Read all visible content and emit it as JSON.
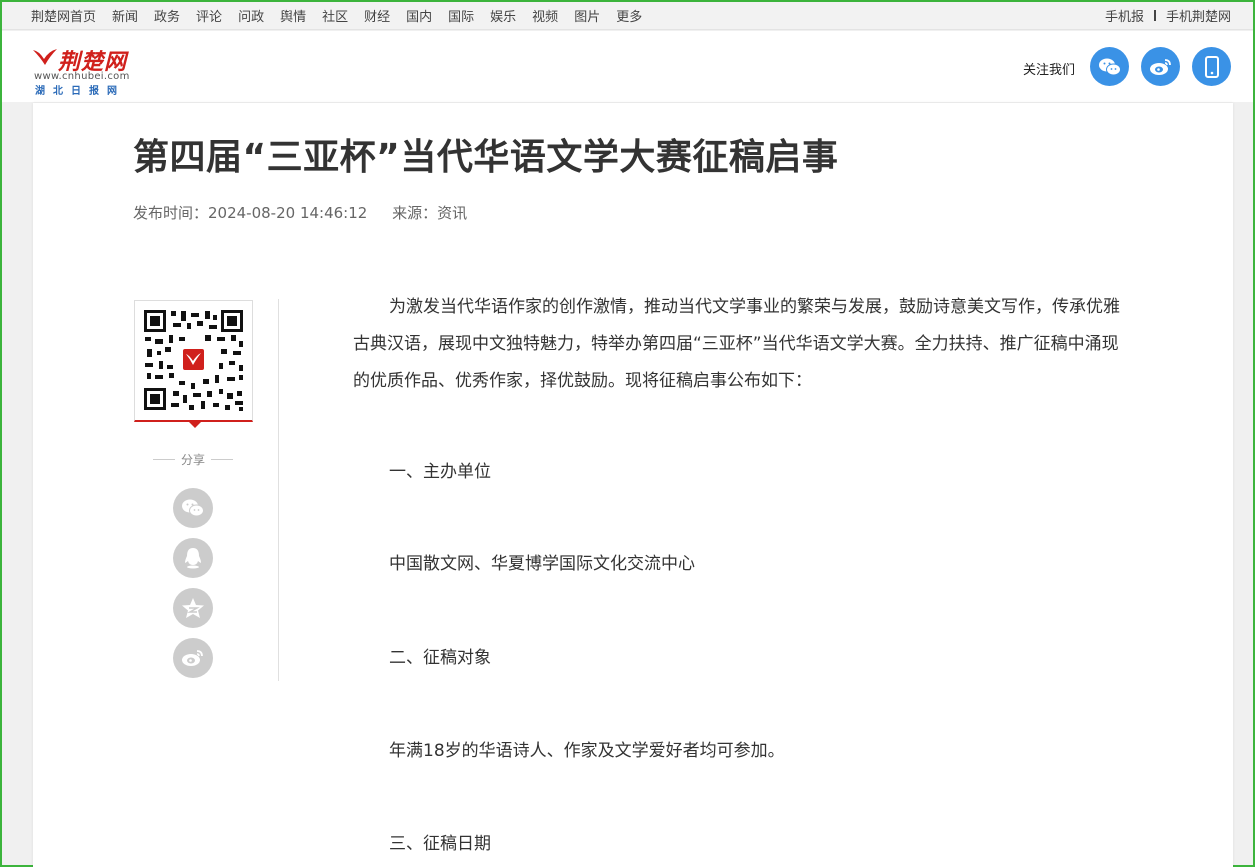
{
  "topnav": {
    "links": [
      "荆楚网首页",
      "新闻",
      "政务",
      "评论",
      "问政",
      "舆情",
      "社区",
      "财经",
      "国内",
      "国际",
      "娱乐",
      "视频",
      "图片",
      "更多"
    ],
    "right": [
      "手机报",
      "手机荆楚网"
    ]
  },
  "header": {
    "logo_name": "荆楚网",
    "logo_url": "www.cnhubei.com",
    "logo_paper": "湖北日报网",
    "follow_label": "关注我们",
    "follow_icons": [
      "wechat-icon",
      "weibo-icon",
      "mobile-icon"
    ]
  },
  "article": {
    "title": "第四届“三亚杯”当代华语文学大赛征稿启事",
    "published": "发布时间：2024-08-20 14:46:12",
    "source": "来源：资讯",
    "paragraphs": [
      "为激发当代华语作家的创作激情，推动当代文学事业的繁荣与发展，鼓励诗意美文写作，传承优雅古典汉语，展现中文独特魅力，特举办第四届“三亚杯”当代华语文学大赛。全力扶持、推广征稿中涌现的优质作品、优秀作家，择优鼓励。现将征稿启事公布如下：",
      "一、主办单位",
      "中国散文网、华夏博学国际文化交流中心",
      "二、征稿对象",
      "年满18岁的华语诗人、作家及文学爱好者均可参加。",
      "三、征稿日期"
    ]
  },
  "share": {
    "label": "分享",
    "icons": [
      "wechat-icon",
      "qq-icon",
      "qzone-icon",
      "weibo-icon"
    ]
  },
  "colors": {
    "brand_red": "#d0201c",
    "follow_blue": "#3a92e6",
    "share_gray": "#cccccc",
    "frame_green": "#3cb43c"
  }
}
